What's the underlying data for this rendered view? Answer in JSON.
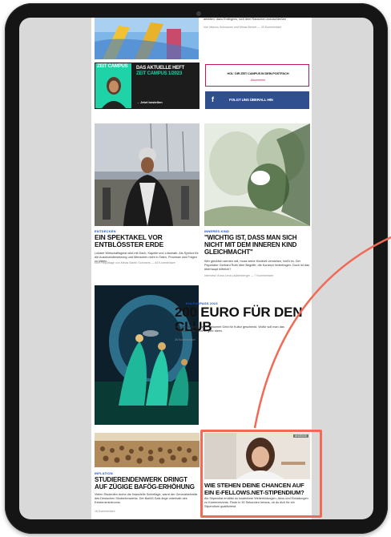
{
  "top_article": {
    "teaser": "arbeiten: dazu Entlegens, sich dem Rauschen anzuschließen",
    "meta": "Von Marcus Schwarzer und Minas Bernet — 33 Kommentare"
  },
  "promo": {
    "logo": "ZEIT CAMPUS",
    "title": "DAS AKTUELLE HEFT",
    "issue": "ZEIT CAMPUS 1/2023",
    "link": "→ Jetzt bestellen"
  },
  "postfach": {
    "label": "HOL' DIR ZEIT CAMPUS IN DEIN POSTFACH",
    "subscribe": "Abonnieren"
  },
  "facebook": {
    "icon_letter": "f",
    "label": "FOLGT UNS ÜBERALL HIN"
  },
  "card_left": {
    "kicker": "ENTDECKEN",
    "headline": "EIN SPEKTAKEL VOR ENTBLÖSSTER ERDE",
    "teaser": "Lokaler Wirtschaftsgeist wird mit Dach, Kapelle und Lützerath. Als Symbol für die Auseinandersetzung und Menschen nicht in Taten, Prozesse und Folgen zu klären.",
    "meta": "Eine Reportage von Minas Martin Sommers — 84 Kommentare"
  },
  "card_right": {
    "kicker": "INNERES KIND",
    "headline": "\"WICHTIG IST, DASS MAN SICH NICHT MIT DEM INNEREN KIND GLEICHMACHT\"",
    "teaser": "Wer glücklich werden will, muss seine Kindheit verstehen, heißt es. Der Psychiater Gerhard Roth über Begriffe, die Konzept hinterfragen. Doch ist das überhaupt hilfreich?",
    "meta": "Interview: Anna Lena Laubenberger — 7 Kommentare"
  },
  "feature": {
    "kicker": "KULTURPASS 2023",
    "headline": "200 EURO FÜR DEN CLUB",
    "teaser": "Wer dieses Jahr 18 wird, bekommt Geld für Kultur geschenkt. Wofür soll man das ausgeben? Hier sind 30 gute Ideen.",
    "meta": "28 Kommentare"
  },
  "card_bottom_left": {
    "kicker": "INFLATION",
    "headline": "STUDIERENDENWERK DRINGT AUF ZÜGIGE BAFÖG-ERHÖHUNG",
    "teaser": "Vielen Studenten drohe die finanzielle Schieflage, warnt der Generalsekretär des Deutschen Studentenwerks. Der BaföG-Satz liege unterhalb des Existenzminimums.",
    "meta": "16 Kommentare"
  },
  "card_bottom_right": {
    "ad_label": "ANZEIGE",
    "headline": "WIE STEHEN DEINE CHANCEN AUF EIN E-FELLOWS.NET-STIPENDIUM?",
    "teaser": "Als Stipendiat erhältst du kostenlose Weiterbildungen, Abos und Einladungen zu Karriereevents. Finde in 30 Sekunden heraus, ob du dich für ein Stipendium qualifizierst."
  },
  "colors": {
    "highlight": "#f26a55",
    "frame": "#151515",
    "promo_bg": "#1c1c1c",
    "accent_green": "#1dd3a7",
    "outline": "#c2185b",
    "facebook": "#2f4f8f",
    "kicker": "#1d4fd6"
  }
}
